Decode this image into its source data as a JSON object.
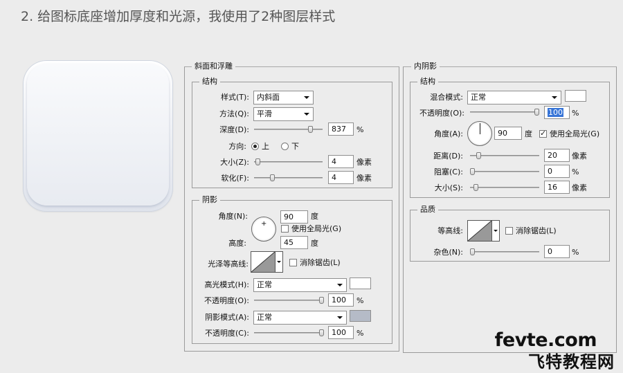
{
  "heading": "2. 给图标底座增加厚度和光源，我使用了2种图层样式",
  "bevel": {
    "title": "斜面和浮雕",
    "structure": {
      "title": "结构",
      "style_label": "样式(T):",
      "style_value": "内斜面",
      "technique_label": "方法(Q):",
      "technique_value": "平滑",
      "depth_label": "深度(D):",
      "depth_value": "837",
      "depth_unit": "%",
      "depth_level": 0.85,
      "direction_label": "方向:",
      "dir_up": "上",
      "dir_down": "下",
      "size_label": "大小(Z):",
      "size_value": "4",
      "size_unit": "像素",
      "size_level": 0.02,
      "soften_label": "软化(F):",
      "soften_value": "4",
      "soften_unit": "像素",
      "soften_level": 0.25
    },
    "shading": {
      "title": "阴影",
      "angle_label": "角度(N):",
      "angle_value": "90",
      "angle_unit": "度",
      "global_light_label": "使用全局光(G)",
      "global_light_checked": false,
      "altitude_label": "高度:",
      "altitude_value": "45",
      "altitude_unit": "度",
      "gloss_label": "光泽等高线:",
      "antialias_label": "消除锯齿(L)",
      "antialias_checked": false,
      "highlight_mode_label": "高光模式(H):",
      "highlight_mode_value": "正常",
      "highlight_color": "#ffffff",
      "highlight_opacity_label": "不透明度(O):",
      "highlight_opacity_value": "100",
      "highlight_opacity_unit": "%",
      "highlight_opacity_level": 1.0,
      "shadow_mode_label": "阴影模式(A):",
      "shadow_mode_value": "正常",
      "shadow_color": "#b5bbc7",
      "shadow_opacity_label": "不透明度(C):",
      "shadow_opacity_value": "100",
      "shadow_opacity_unit": "%",
      "shadow_opacity_level": 1.0
    }
  },
  "inner_shadow": {
    "title": "内阴影",
    "structure": {
      "title": "结构",
      "blend_label": "混合模式:",
      "blend_value": "正常",
      "blend_color": "#ffffff",
      "opacity_label": "不透明度(O):",
      "opacity_value": "100",
      "opacity_unit": "%",
      "opacity_level": 1.0,
      "angle_label": "角度(A):",
      "angle_value": "90",
      "angle_unit": "度",
      "global_light_label": "使用全局光(G)",
      "global_light_checked": true,
      "distance_label": "距离(D):",
      "distance_value": "20",
      "distance_unit": "像素",
      "distance_level": 0.1,
      "choke_label": "阻塞(C):",
      "choke_value": "0",
      "choke_unit": "%",
      "choke_level": 0.0,
      "size_label": "大小(S):",
      "size_value": "16",
      "size_unit": "像素",
      "size_level": 0.05
    },
    "quality": {
      "title": "品质",
      "contour_label": "等高线:",
      "antialias_label": "消除锯齿(L)",
      "antialias_checked": false,
      "noise_label": "杂色(N):",
      "noise_value": "0",
      "noise_unit": "%",
      "noise_level": 0.0
    }
  },
  "watermark": {
    "line1": "fevte.com",
    "line2": "飞特教程网"
  }
}
